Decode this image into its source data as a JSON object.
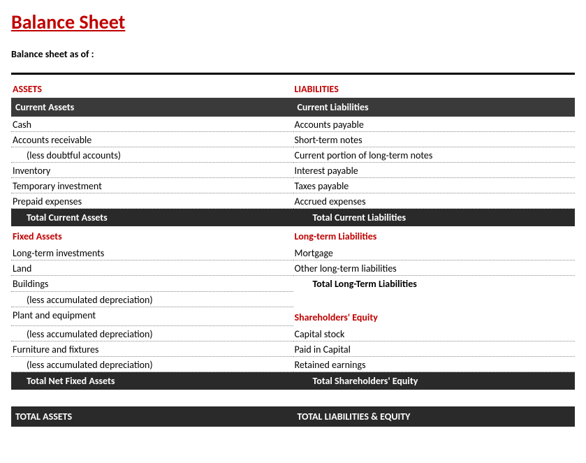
{
  "title": "Balance Sheet",
  "subtitle": "Balance sheet as of :",
  "assets": {
    "heading": "ASSETS",
    "current": {
      "label": "Current Assets",
      "items": [
        "Cash",
        "Accounts receivable",
        "(less doubtful accounts)",
        "Inventory",
        "Temporary investment",
        "Prepaid expenses"
      ],
      "total": "Total Current Assets"
    },
    "fixed": {
      "label": "Fixed Assets",
      "items": [
        "Long-term investments",
        "Land",
        "Buildings",
        "(less accumulated depreciation)",
        "Plant and equipment",
        "(less accumulated depreciation)",
        "Furniture and fixtures",
        "(less accumulated depreciation)"
      ],
      "total": "Total Net Fixed Assets"
    },
    "grand_total": "TOTAL ASSETS"
  },
  "liabilities": {
    "heading": "LIABILITIES",
    "current": {
      "label": "Current Liabilities",
      "items": [
        "Accounts payable",
        "Short-term notes",
        "Current portion of long-term notes",
        "Interest payable",
        "Taxes payable",
        "Accrued expenses"
      ],
      "total": "Total Current Liabilities"
    },
    "longterm": {
      "label": "Long-term Liabilities",
      "items": [
        "Mortgage",
        "Other long-term liabilities"
      ],
      "total": "Total Long-Term Liabilities"
    },
    "equity": {
      "label": "Shareholders' Equity",
      "items": [
        "Capital stock",
        "Paid in Capital",
        "Retained earnings"
      ],
      "total": "Total Shareholders' Equity"
    },
    "grand_total": "TOTAL LIABILITIES & EQUITY"
  }
}
